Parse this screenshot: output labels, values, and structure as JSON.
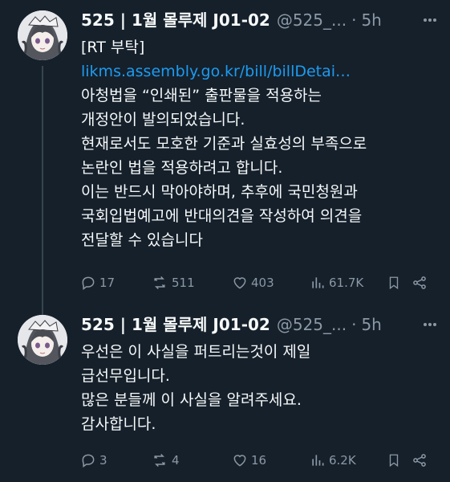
{
  "tweets": [
    {
      "author": {
        "name": "525 | 1월 몰루제 J01-02",
        "handle": "@525_...",
        "time": "5h"
      },
      "lines": [
        {
          "text": "[RT 부탁]",
          "kind": "text"
        },
        {
          "text": "likms.assembly.go.kr/bill/billDetai…",
          "kind": "link"
        },
        {
          "text": "아청법을 “인쇄된” 출판물을 적용하는",
          "kind": "text"
        },
        {
          "text": "개정안이 발의되었습니다.",
          "kind": "text"
        },
        {
          "text": "현재로서도 모호한 기준과 실효성의 부족으로",
          "kind": "text"
        },
        {
          "text": "논란인 법을 적용하려고 합니다.",
          "kind": "text"
        },
        {
          "text": "이는 반드시 막아야하며, 추후에 국민청원과",
          "kind": "text"
        },
        {
          "text": "국회입법예고에 반대의견을 작성하여 의견을",
          "kind": "text"
        },
        {
          "text": "전달할 수 있습니다",
          "kind": "text"
        }
      ],
      "stats": {
        "replies": "17",
        "reposts": "511",
        "likes": "403",
        "views": "61.7K"
      }
    },
    {
      "author": {
        "name": "525 | 1월 몰루제 J01-02",
        "handle": "@525_...",
        "time": "5h"
      },
      "lines": [
        {
          "text": "우선은 이 사실을 퍼트리는것이 제일",
          "kind": "text"
        },
        {
          "text": "급선무입니다.",
          "kind": "text"
        },
        {
          "text": "많은 분들께 이 사실을 알려주세요.",
          "kind": "text"
        },
        {
          "text": "감사합니다.",
          "kind": "text"
        }
      ],
      "stats": {
        "replies": "3",
        "reposts": "4",
        "likes": "16",
        "views": "6.2K"
      }
    }
  ],
  "icons": {
    "reply": "reply-icon",
    "repost": "repost-icon",
    "like": "heart-icon",
    "views": "views-icon",
    "bookmark": "bookmark-icon",
    "share": "share-icon",
    "more": "more-icon"
  },
  "colors": {
    "background": "#15202b",
    "text": "#f7f9f9",
    "secondary": "#8b98a5",
    "link": "#1d9bf0"
  }
}
